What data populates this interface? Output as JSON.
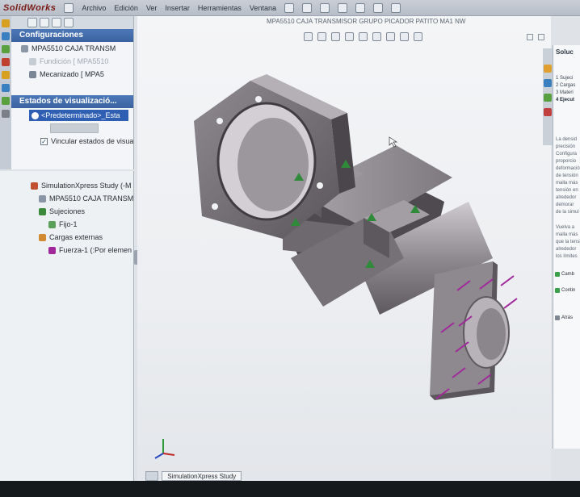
{
  "menubar": {
    "logo": "SolidWorks",
    "items": [
      "Archivo",
      "Edición",
      "Ver",
      "Insertar",
      "Herramientas",
      "Ventana"
    ]
  },
  "document_title": "MPA5510 CAJA TRANSMISOR GRUPO PICADOR PATITO MA1 NW",
  "config_manager": {
    "title": "Configuraciones",
    "part_name": "MPA5510 CAJA TRANSM",
    "config_fundicion": "Fundición [ MPA5510",
    "config_mecanizado": "Mecanizado [ MPA5",
    "display_states_title": "Estados de visualizació...",
    "display_state_selected": "<Predeterminado>_Esta",
    "link_display_states_label": "Vincular estados de visualizac"
  },
  "simulation_tree": {
    "study": "SimulationXpress Study (-M",
    "part": "MPA5510 CAJA TRANSM",
    "fixtures_label": "Sujeciones",
    "fixture_item": "Fijo-1",
    "loads_label": "Cargas externas",
    "load_item": "Fuerza-1 (:Por elemen"
  },
  "bottom_tabs": [
    "SimulationXpress Study"
  ],
  "task_pane": {
    "title": "Soluc",
    "steps": [
      "1 Sujeci",
      "2 Cargas",
      "3 Materi",
      "4 Ejecut"
    ],
    "active_step_index": 3,
    "body_lines": [
      "La densid",
      "precisión",
      "Configura",
      "proporcio",
      "deformació",
      "de tensión",
      "malla más",
      "tensión en",
      "alrededor",
      "demorar",
      "de la simul"
    ],
    "body_lines_2": [
      "Vuelva a",
      "malla más",
      "que la tensión",
      "alrededor",
      "los límites"
    ],
    "option_1": "Camb",
    "option_2": "Contin",
    "back_label": "Atrás"
  },
  "colors": {
    "fixture_marker": "#2f8a3a",
    "force_arrow": "#a0289a",
    "selection": "#2f5fb3",
    "panel_header": "#3f69a8"
  }
}
